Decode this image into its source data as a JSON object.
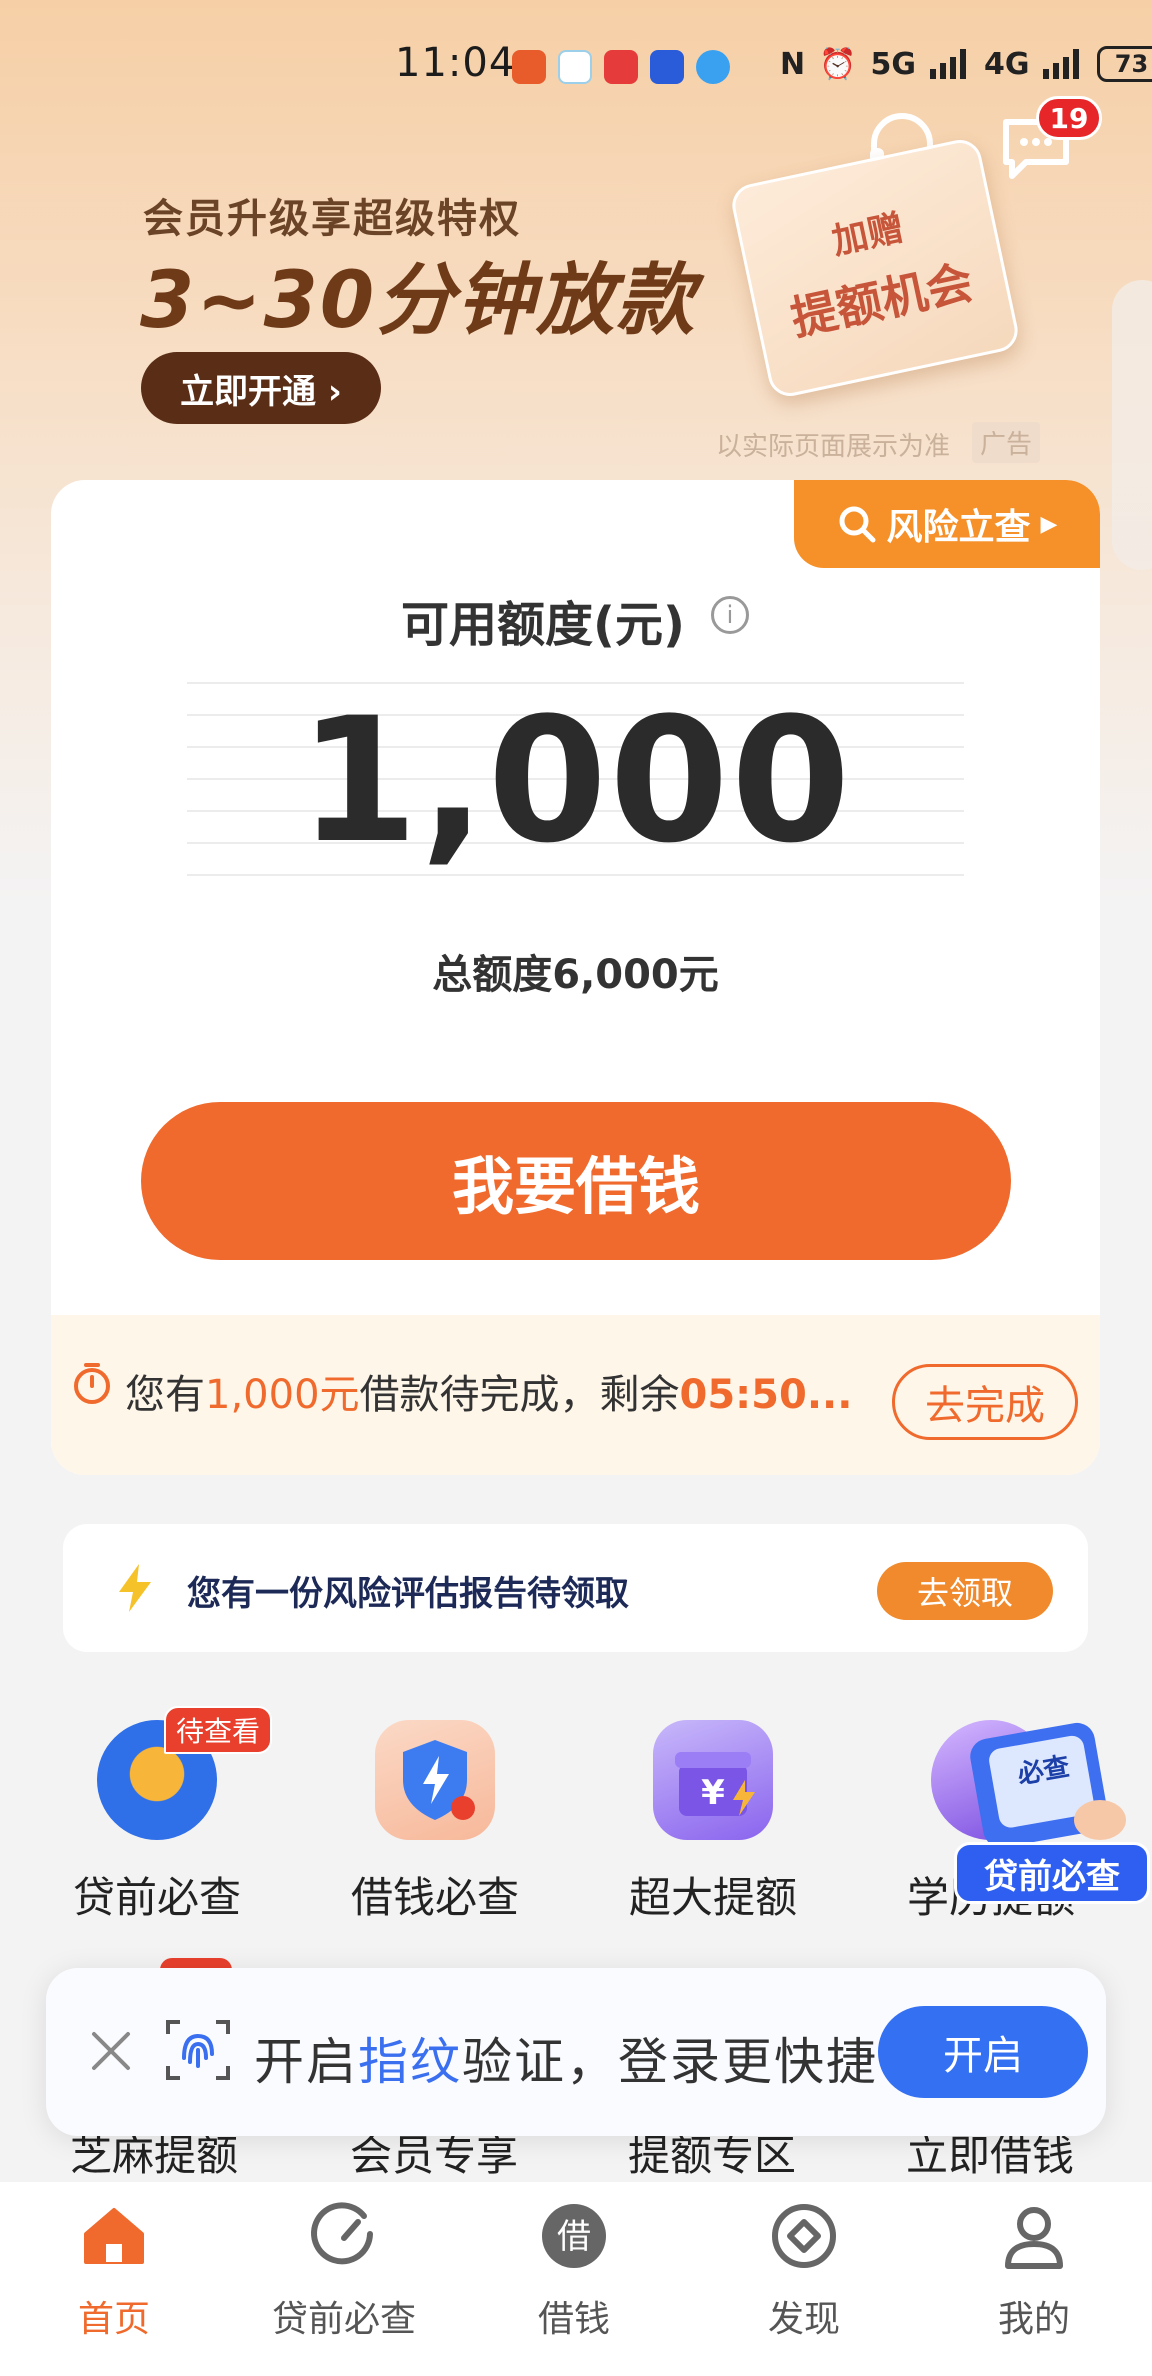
{
  "status_bar": {
    "time": "11:04",
    "network1": "5G",
    "network2": "4G",
    "battery": "73"
  },
  "header": {
    "message_badge": "19"
  },
  "banner": {
    "subtitle": "会员升级享超级特权",
    "title": "3~30分钟放款",
    "button": "立即开通 ›",
    "promo_small": "加赠",
    "promo_big": "提额机会",
    "note": "以实际页面展示为准",
    "ad_tag": "广告"
  },
  "card": {
    "risk_button": "风险立查",
    "quota_label": "可用额度(元)",
    "amount": "1,000",
    "total_quota": "总额度6,000元",
    "borrow_button": "我要借钱",
    "pending_prefix": "您有",
    "pending_amount": "1,000元",
    "pending_middle": "借款待完成，剩余",
    "pending_time": "05:50...",
    "complete_button": "去完成"
  },
  "report": {
    "text": "您有一份风险评估报告待领取",
    "button": "去领取"
  },
  "features": {
    "row1": [
      {
        "label": "贷前必查",
        "badge": "待查看"
      },
      {
        "label": "借钱必查"
      },
      {
        "label": "超大提额"
      },
      {
        "label": "学历提额"
      }
    ],
    "floating_badge": "贷前必查",
    "floating_icon_text": "必查",
    "row2": [
      "芝麻提额",
      "会员专享",
      "提额专区",
      "立即借钱"
    ]
  },
  "toast": {
    "text_prefix": "开启",
    "text_highlight": "指纹",
    "text_suffix": "验证，登录更快捷",
    "button": "开启"
  },
  "bottom_nav": [
    {
      "label": "首页",
      "icon": "home-icon",
      "active": true
    },
    {
      "label": "贷前必查",
      "icon": "gauge-icon",
      "active": false
    },
    {
      "label": "借钱",
      "icon": "borrow-icon",
      "active": false,
      "icon_text": "借"
    },
    {
      "label": "发现",
      "icon": "discover-icon",
      "active": false
    },
    {
      "label": "我的",
      "icon": "profile-icon",
      "active": false
    }
  ],
  "colors": {
    "accent": "#ef6a2c",
    "risk_button": "#f6912a",
    "toast_button": "#3470f2",
    "banner_button": "#5a2d16"
  }
}
